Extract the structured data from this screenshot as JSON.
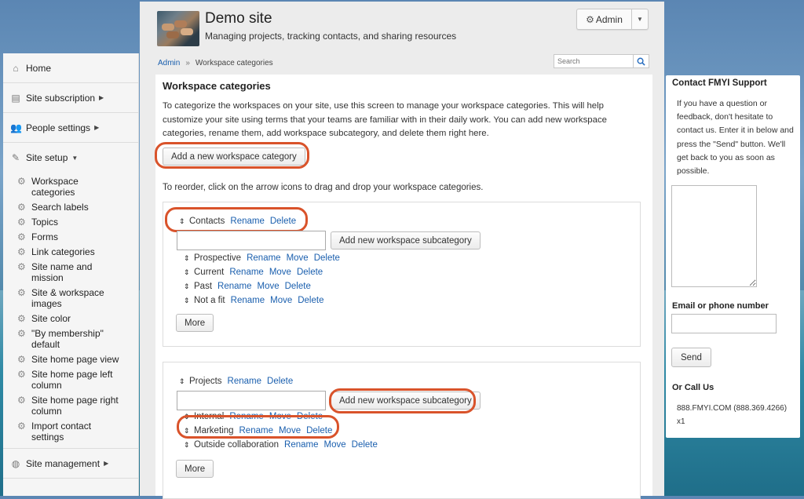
{
  "header": {
    "site_title": "Demo site",
    "site_subtitle": "Managing projects, tracking contacts, and sharing resources",
    "admin_label": "Admin"
  },
  "breadcrumb": {
    "root": "Admin",
    "separator": "»",
    "current": "Workspace categories"
  },
  "search": {
    "placeholder": "Search"
  },
  "sidebar": {
    "items": [
      {
        "label": "Home",
        "icon": "home-icon"
      },
      {
        "label": "Site subscription",
        "icon": "subscription-icon"
      },
      {
        "label": "People settings",
        "icon": "people-icon"
      },
      {
        "label": "Site setup",
        "icon": "wrench-icon"
      }
    ],
    "setup_items": [
      "Workspace categories",
      "Search labels",
      "Topics",
      "Forms",
      "Link categories",
      "Site name and mission",
      "Site & workspace images",
      "Site color",
      "\"By membership\" default",
      "Site home page view",
      "Site home page left column",
      "Site home page right column",
      "Import contact settings"
    ],
    "management": {
      "label": "Site management",
      "icon": "globe-icon"
    }
  },
  "main": {
    "title": "Workspace categories",
    "intro": "To categorize the workspaces on your site, use this screen to manage your workspace categories. This will help customize your site using terms that your teams are familiar with in their daily work. You can add new workspace categories, rename them, add workspace subcategory, and delete them right here.",
    "add_category_label": "Add a new workspace category",
    "reorder_text": "To reorder, click on the arrow icons to drag and drop your workspace categories.",
    "add_sub_label": "Add new workspace subcategory",
    "more_label": "More",
    "rename": "Rename",
    "move": "Move",
    "delete": "Delete",
    "categories": [
      {
        "name": "Contacts",
        "subcategories": [
          "Prospective",
          "Current",
          "Past",
          "Not a fit"
        ]
      },
      {
        "name": "Projects",
        "subcategories": [
          "Internal",
          "Marketing",
          "Outside collaboration"
        ]
      }
    ]
  },
  "support": {
    "title": "Contact FMYI Support",
    "text": "If you have a question or feedback, don't hesitate to contact us. Enter it in below and press the \"Send\" button. We'll get back to you as soon as possible.",
    "email_label": "Email or phone number",
    "send_label": "Send",
    "call_title": "Or Call Us",
    "phone": "888.FMYI.COM (888.369.4266) x1"
  },
  "colors": {
    "highlight": "#d9532b",
    "link": "#1a5fae"
  }
}
